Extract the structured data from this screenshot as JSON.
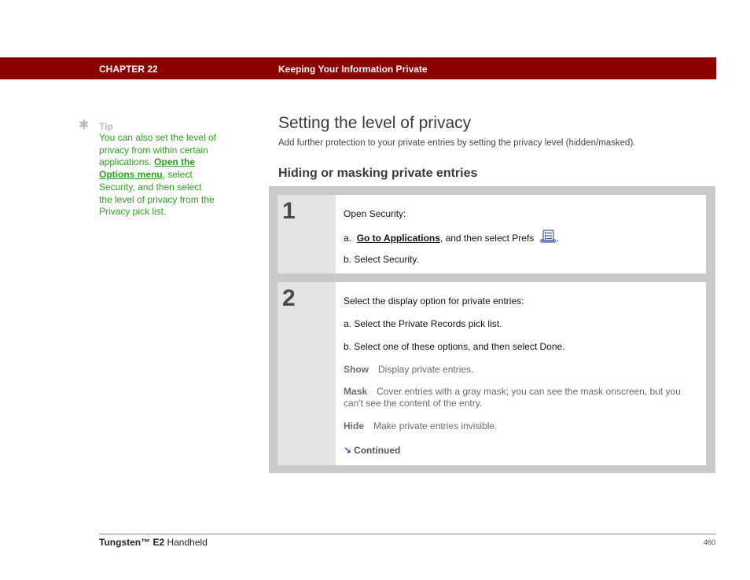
{
  "header": {
    "chapter": "CHAPTER 22",
    "chapter_title": "Keeping Your Information Private",
    "bar_color": "#8c0000"
  },
  "tip": {
    "icon": "asterisk-icon",
    "label": "Tip",
    "text_before": "You can also set the level of privacy from within certain applications. ",
    "link": "Open the Options menu",
    "text_after": ", select Security, and then select the level of privacy from the Privacy pick list.",
    "color": "#2ca11e"
  },
  "main": {
    "title": "Setting the level of privacy",
    "intro": "Add further protection to your private entries by setting the privacy level (hidden/masked).",
    "subhead": "Hiding or masking private entries"
  },
  "steps": [
    {
      "number": "1",
      "intro": "Open Security:",
      "a_prefix": "a.",
      "a_link": "Go to Applications",
      "a_rest": ", and then select Prefs",
      "a_end": ".",
      "a_icon": "prefs-icon",
      "b": "b.  Select Security."
    },
    {
      "number": "2",
      "intro": "Select the display option for private entries:",
      "a": "a.  Select the Private Records pick list.",
      "b": "b.  Select one of these options, and then select Done.",
      "options": [
        {
          "label": "Show",
          "text": "Display private entries."
        },
        {
          "label": "Mask",
          "text": "Cover entries with a gray mask; you can see the mask onscreen, but you can't see the content of the entry."
        },
        {
          "label": "Hide",
          "text": "Make private entries invisible."
        }
      ],
      "continued": "Continued",
      "continued_icon": "arrow-down-right-icon"
    }
  ],
  "footer": {
    "product_bold": "Tungsten™ E2",
    "product_rest": " Handheld",
    "page": "460"
  }
}
